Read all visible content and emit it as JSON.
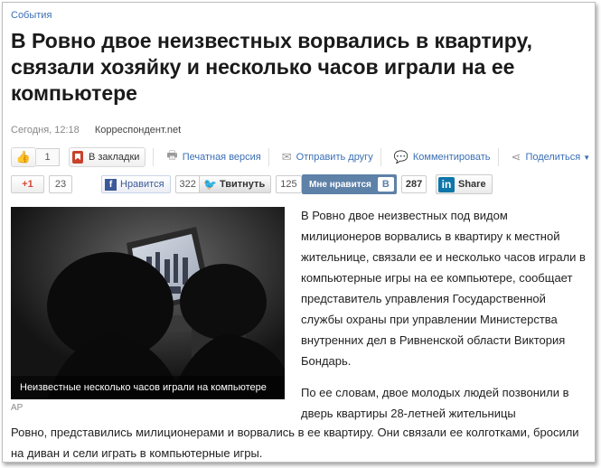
{
  "article": {
    "category": "События",
    "title": "В Ровно двое неизвестных ворвались в квартиру, связали хозяйку и несколько часов играли на ее компьютере",
    "time": "Сегодня, 12:18",
    "source": "Корреспондент.net"
  },
  "toolbar": {
    "like_count": "1",
    "bookmark_label": "В закладки",
    "print_label": "Печатная версия",
    "send_label": "Отправить другу",
    "comment_label": "Комментировать",
    "share_label": "Поделиться"
  },
  "social": {
    "gplus_label": "+1",
    "gplus_count": "23",
    "fb_label": "Нравится",
    "fb_count": "322",
    "tw_label": "Твитнуть",
    "tw_count": "125",
    "vk_label": "Мне нравится",
    "vk_logo": "В",
    "vk_count": "287",
    "li_label": "Share",
    "li_logo": "in"
  },
  "photo": {
    "caption": "Неизвестные несколько часов играли на компьютере",
    "credit": "AP"
  },
  "body": {
    "p1": "В Ровно двое неизвестных под видом милиционеров ворвались в квартиру к местной жительнице, связали ее и несколько часов играли в компьютерные игры на ее компьютере, сообщает представитель управления Государственной службы охраны при управлении Министерства внутренних дел в Ривненской области Виктория Бондарь.",
    "p2_start": "По ее словам, двое молодых людей позвонили в дверь квартиры 28-летней жительницы",
    "p2_end": "Ровно, представились милиционерами и ворвались в ее квартиру. Они связали ее колготками, бросили на диван и сели играть в компьютерные игры."
  }
}
